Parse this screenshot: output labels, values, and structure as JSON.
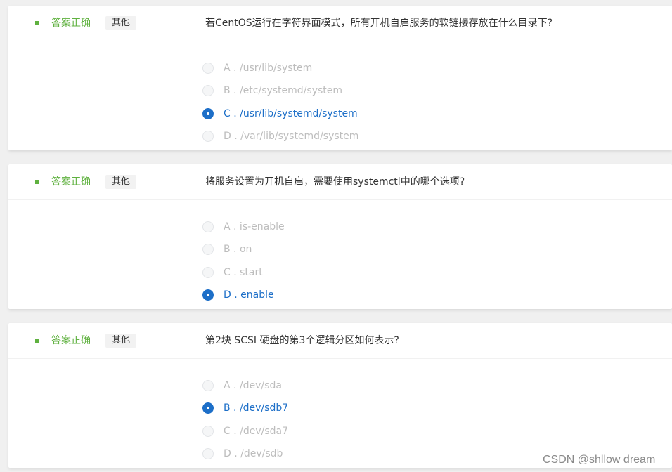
{
  "colors": {
    "status_green": "#5fb13f",
    "tag_bg": "#f2f2f2",
    "tag_text": "#333333",
    "question_text": "#333333",
    "option_muted": "#bdbdbd",
    "option_selected": "#1d6fc8",
    "watermark": "#8a8a8a"
  },
  "questions": [
    {
      "status": "答案正确",
      "tag": "其他",
      "text": "若CentOS运行在字符界面模式，所有开机自启服务的软链接存放在什么目录下?",
      "options": [
        {
          "label": "A . /usr/lib/system",
          "selected": false
        },
        {
          "label": "B . /etc/systemd/system",
          "selected": false
        },
        {
          "label": "C . /usr/lib/systemd/system",
          "selected": true
        },
        {
          "label": "D . /var/lib/systemd/system",
          "selected": false
        }
      ]
    },
    {
      "status": "答案正确",
      "tag": "其他",
      "text": "将服务设置为开机自启，需要使用systemctl中的哪个选项?",
      "options": [
        {
          "label": "A . is-enable",
          "selected": false
        },
        {
          "label": "B . on",
          "selected": false
        },
        {
          "label": "C . start",
          "selected": false
        },
        {
          "label": "D . enable",
          "selected": true
        }
      ]
    },
    {
      "status": "答案正确",
      "tag": "其他",
      "text": "第2块 SCSI 硬盘的第3个逻辑分区如何表示?",
      "options": [
        {
          "label": "A . /dev/sda",
          "selected": false
        },
        {
          "label": "B . /dev/sdb7",
          "selected": true
        },
        {
          "label": "C . /dev/sda7",
          "selected": false
        },
        {
          "label": "D . /dev/sdb",
          "selected": false
        }
      ]
    }
  ],
  "watermark": "CSDN @shllow dream"
}
